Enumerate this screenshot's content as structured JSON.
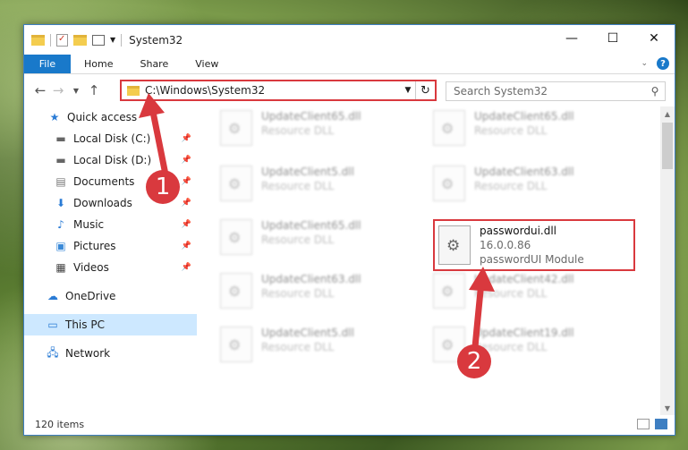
{
  "window": {
    "title": "System32"
  },
  "controls": {
    "minimize": "—",
    "maximize": "☐",
    "close": "✕"
  },
  "ribbon": {
    "file": "File",
    "tabs": [
      "Home",
      "Share",
      "View"
    ],
    "help": "?"
  },
  "address": {
    "path": "C:\\Windows\\System32"
  },
  "search": {
    "placeholder": "Search System32"
  },
  "sidebar": {
    "items": [
      {
        "label": "Quick access",
        "icon": "star-icon"
      },
      {
        "label": "Local Disk (C:)",
        "icon": "drive-icon"
      },
      {
        "label": "Local Disk (D:)",
        "icon": "drive-icon"
      },
      {
        "label": "Documents",
        "icon": "documents-icon"
      },
      {
        "label": "Downloads",
        "icon": "download-icon"
      },
      {
        "label": "Music",
        "icon": "music-icon"
      },
      {
        "label": "Pictures",
        "icon": "pictures-icon"
      },
      {
        "label": "Videos",
        "icon": "videos-icon"
      },
      {
        "label": "OneDrive",
        "icon": "cloud-icon"
      },
      {
        "label": "This PC",
        "icon": "computer-icon"
      },
      {
        "label": "Network",
        "icon": "network-icon"
      }
    ]
  },
  "files": [
    {
      "name": "UpdateClient65.dll",
      "desc": "Resource DLL"
    },
    {
      "name": "UpdateClient65.dll",
      "desc": "Resource DLL"
    },
    {
      "name": "UpdateClient5.dll",
      "desc": "Resource DLL"
    },
    {
      "name": "UpdateClient63.dll",
      "desc": "Resource DLL"
    },
    {
      "name": "UpdateClient65.dll",
      "desc": "Resource DLL"
    },
    {
      "name": "UpdateClient63.dll",
      "desc": "Resource DLL"
    },
    {
      "name": "UpdateClient42.dll",
      "desc": "Resource DLL"
    },
    {
      "name": "UpdateClient5.dll",
      "desc": "Resource DLL"
    },
    {
      "name": "UpdateClient19.dll",
      "desc": "Resource DLL"
    }
  ],
  "highlighted_file": {
    "name": "passwordui.dll",
    "version": "16.0.0.86",
    "description": "passwordUI Module"
  },
  "status": {
    "count": "120 items"
  },
  "markers": {
    "one": "1",
    "two": "2"
  },
  "colors": {
    "accent": "#1979ca",
    "highlight": "#d9393e",
    "selection": "#cde8ff"
  }
}
